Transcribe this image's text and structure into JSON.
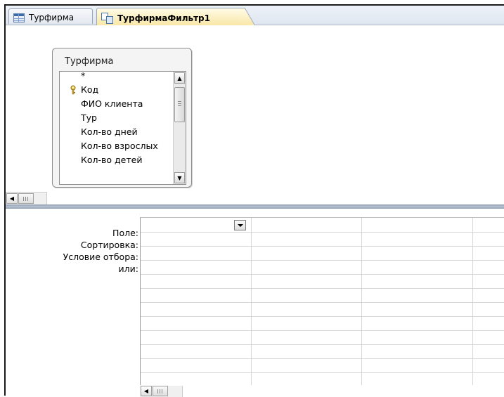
{
  "tabs": [
    {
      "label": "Турфирма",
      "icon": "table-icon",
      "active": false
    },
    {
      "label": "ТурфирмаФильтр1",
      "icon": "query-icon",
      "active": true
    }
  ],
  "field_list": {
    "title": "Турфирма",
    "items": [
      {
        "label": "*",
        "key": false
      },
      {
        "label": "Код",
        "key": true
      },
      {
        "label": "ФИО клиента",
        "key": false
      },
      {
        "label": "Тур",
        "key": false
      },
      {
        "label": "Кол-во дней",
        "key": false
      },
      {
        "label": "Кол-во взрослых",
        "key": false
      },
      {
        "label": "Кол-во детей",
        "key": false
      }
    ]
  },
  "design_grid": {
    "row_labels": [
      "Поле:",
      "Сортировка:",
      "Условие отбора:",
      "или:"
    ]
  },
  "colors": {
    "active_tab": "#f9e7a7",
    "splitter": "#8d9bb0",
    "grid_lines": "#d7d7d7"
  }
}
